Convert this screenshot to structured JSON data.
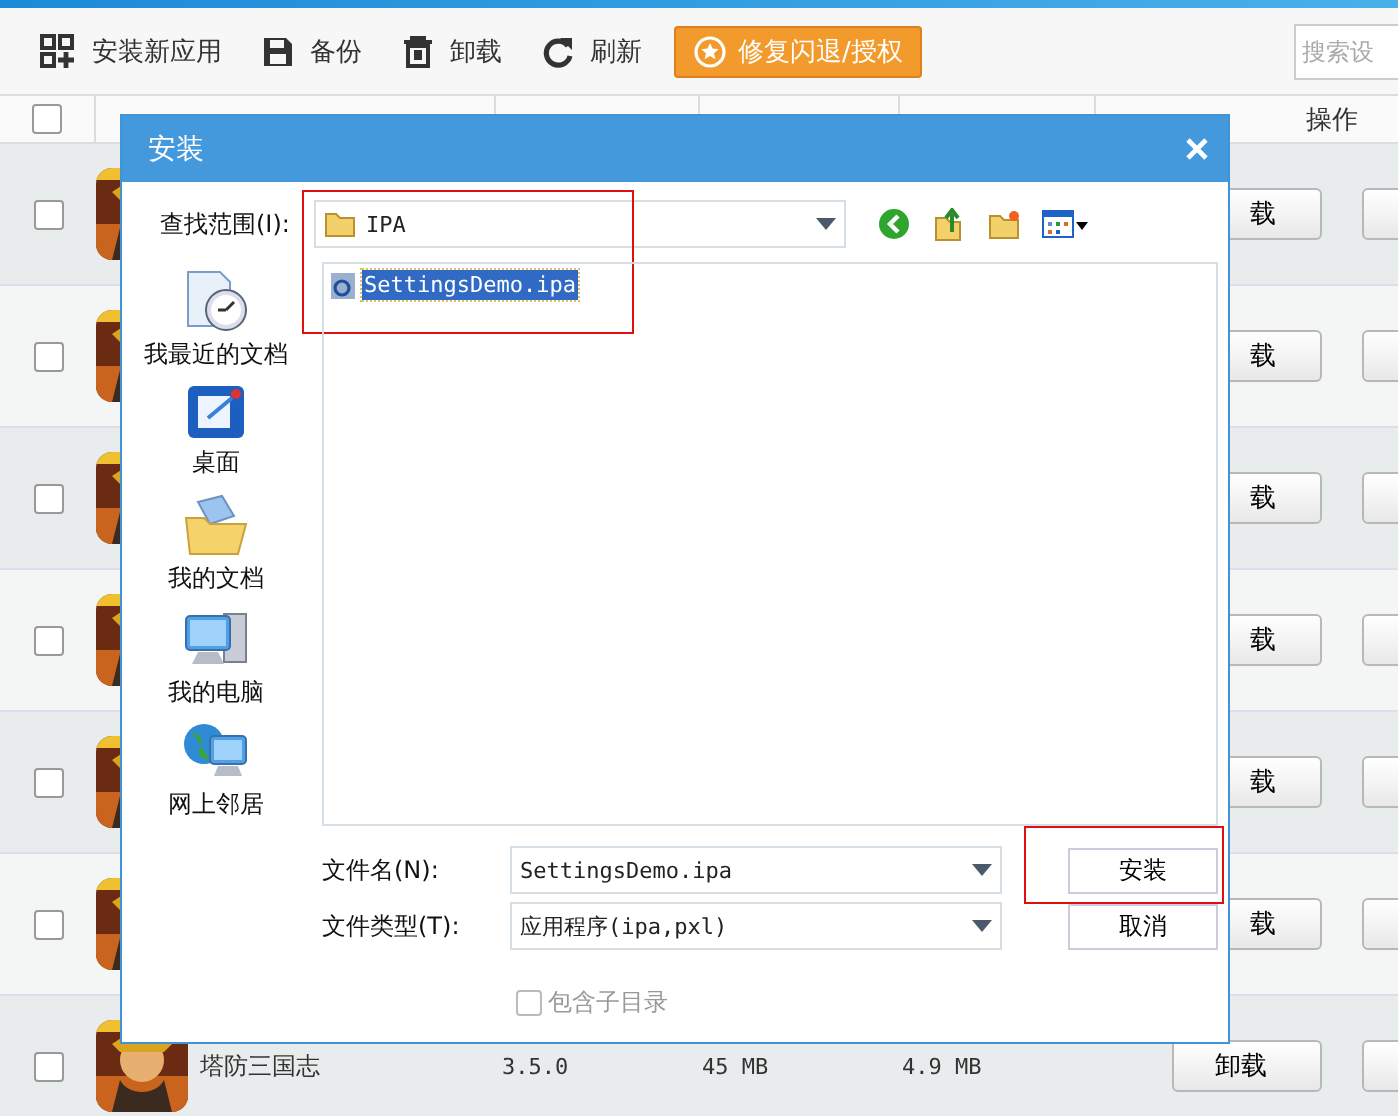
{
  "toolbar": {
    "items": [
      {
        "kind": "grid",
        "label": "安装新应用"
      },
      {
        "kind": "save",
        "label": "备份"
      },
      {
        "kind": "trash",
        "label": "卸载"
      },
      {
        "kind": "refresh",
        "label": "刷新"
      }
    ],
    "repair_button": "修复闪退/授权",
    "search": {
      "placeholder": "搜索设"
    }
  },
  "table": {
    "action_column": "操作",
    "header_checked": false,
    "rows": [
      {
        "checked": false,
        "action": "载"
      },
      {
        "checked": false,
        "action": "载"
      },
      {
        "checked": false,
        "action": "载"
      },
      {
        "checked": false,
        "action": "载"
      },
      {
        "checked": false,
        "action": "载"
      },
      {
        "checked": false,
        "action": "载"
      },
      {
        "checked": false,
        "name": "塔防三国志",
        "version": "3.5.0",
        "app_size": "45 MB",
        "doc_size": "4.9 MB",
        "action": "卸载"
      }
    ]
  },
  "dialog": {
    "title": "安装",
    "look_in": {
      "label": "查找范围(I):",
      "value": "IPA",
      "highlighted": true
    },
    "places": [
      {
        "kind": "recent",
        "label": "我最近的文档"
      },
      {
        "kind": "desktop",
        "label": "桌面"
      },
      {
        "kind": "documents",
        "label": "我的文档"
      },
      {
        "kind": "computer",
        "label": "我的电脑"
      },
      {
        "kind": "network",
        "label": "网上邻居"
      }
    ],
    "files": [
      {
        "name": "SettingsDemo.ipa",
        "selected": true
      }
    ],
    "filename": {
      "label": "文件名(N):",
      "value": "SettingsDemo.ipa"
    },
    "filetype": {
      "label": "文件类型(T):",
      "value": "应用程序(ipa,pxl)"
    },
    "install_button": {
      "label": "安装",
      "highlighted": true
    },
    "cancel_button": {
      "label": "取消"
    },
    "subdirs": {
      "label": "包含子目录",
      "checked": false,
      "disabled": true
    }
  }
}
